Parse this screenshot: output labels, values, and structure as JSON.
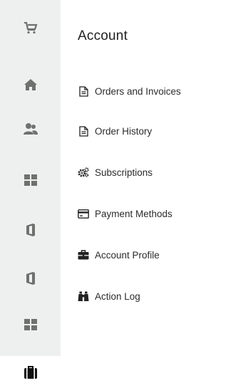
{
  "rail": {
    "items": [
      {
        "icon": "cart-icon"
      },
      {
        "icon": "home-icon"
      },
      {
        "icon": "users-icon"
      },
      {
        "icon": "grid-icon"
      },
      {
        "icon": "office-icon"
      },
      {
        "icon": "office-icon"
      },
      {
        "icon": "grid-icon"
      },
      {
        "icon": "briefcase-icon",
        "active": true
      }
    ]
  },
  "panel": {
    "title": "Account",
    "items": [
      {
        "label": "Orders and Invoices",
        "icon": "document-icon"
      },
      {
        "label": "Order History",
        "icon": "document-icon"
      },
      {
        "label": "Subscriptions",
        "icon": "gears-icon"
      },
      {
        "label": "Payment Methods",
        "icon": "credit-card-icon"
      },
      {
        "label": "Account Profile",
        "icon": "briefcase-icon"
      },
      {
        "label": "Action Log",
        "icon": "binoculars-icon"
      }
    ]
  },
  "colors": {
    "rail_bg": "#eef0ef",
    "rail_icon": "#6f716f",
    "active_icon": "#111111"
  }
}
